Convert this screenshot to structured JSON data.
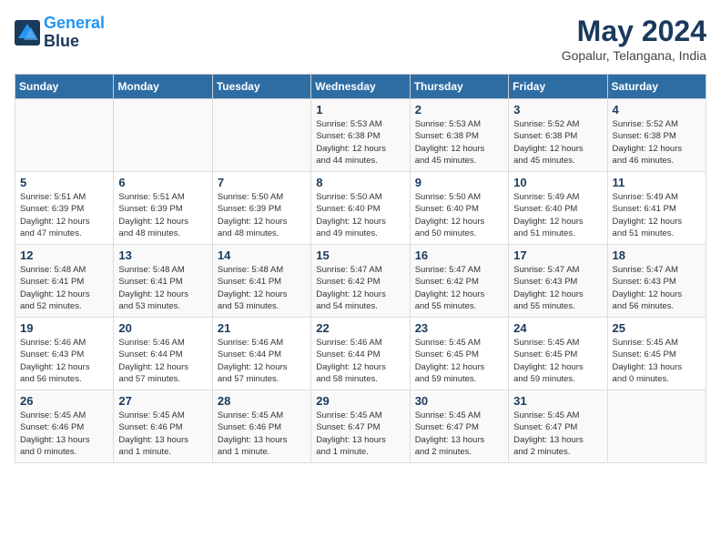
{
  "header": {
    "logo_line1": "General",
    "logo_line2": "Blue",
    "month_title": "May 2024",
    "subtitle": "Gopalur, Telangana, India"
  },
  "days_of_week": [
    "Sunday",
    "Monday",
    "Tuesday",
    "Wednesday",
    "Thursday",
    "Friday",
    "Saturday"
  ],
  "weeks": [
    [
      {
        "day": "",
        "info": ""
      },
      {
        "day": "",
        "info": ""
      },
      {
        "day": "",
        "info": ""
      },
      {
        "day": "1",
        "info": "Sunrise: 5:53 AM\nSunset: 6:38 PM\nDaylight: 12 hours\nand 44 minutes."
      },
      {
        "day": "2",
        "info": "Sunrise: 5:53 AM\nSunset: 6:38 PM\nDaylight: 12 hours\nand 45 minutes."
      },
      {
        "day": "3",
        "info": "Sunrise: 5:52 AM\nSunset: 6:38 PM\nDaylight: 12 hours\nand 45 minutes."
      },
      {
        "day": "4",
        "info": "Sunrise: 5:52 AM\nSunset: 6:38 PM\nDaylight: 12 hours\nand 46 minutes."
      }
    ],
    [
      {
        "day": "5",
        "info": "Sunrise: 5:51 AM\nSunset: 6:39 PM\nDaylight: 12 hours\nand 47 minutes."
      },
      {
        "day": "6",
        "info": "Sunrise: 5:51 AM\nSunset: 6:39 PM\nDaylight: 12 hours\nand 48 minutes."
      },
      {
        "day": "7",
        "info": "Sunrise: 5:50 AM\nSunset: 6:39 PM\nDaylight: 12 hours\nand 48 minutes."
      },
      {
        "day": "8",
        "info": "Sunrise: 5:50 AM\nSunset: 6:40 PM\nDaylight: 12 hours\nand 49 minutes."
      },
      {
        "day": "9",
        "info": "Sunrise: 5:50 AM\nSunset: 6:40 PM\nDaylight: 12 hours\nand 50 minutes."
      },
      {
        "day": "10",
        "info": "Sunrise: 5:49 AM\nSunset: 6:40 PM\nDaylight: 12 hours\nand 51 minutes."
      },
      {
        "day": "11",
        "info": "Sunrise: 5:49 AM\nSunset: 6:41 PM\nDaylight: 12 hours\nand 51 minutes."
      }
    ],
    [
      {
        "day": "12",
        "info": "Sunrise: 5:48 AM\nSunset: 6:41 PM\nDaylight: 12 hours\nand 52 minutes."
      },
      {
        "day": "13",
        "info": "Sunrise: 5:48 AM\nSunset: 6:41 PM\nDaylight: 12 hours\nand 53 minutes."
      },
      {
        "day": "14",
        "info": "Sunrise: 5:48 AM\nSunset: 6:41 PM\nDaylight: 12 hours\nand 53 minutes."
      },
      {
        "day": "15",
        "info": "Sunrise: 5:47 AM\nSunset: 6:42 PM\nDaylight: 12 hours\nand 54 minutes."
      },
      {
        "day": "16",
        "info": "Sunrise: 5:47 AM\nSunset: 6:42 PM\nDaylight: 12 hours\nand 55 minutes."
      },
      {
        "day": "17",
        "info": "Sunrise: 5:47 AM\nSunset: 6:43 PM\nDaylight: 12 hours\nand 55 minutes."
      },
      {
        "day": "18",
        "info": "Sunrise: 5:47 AM\nSunset: 6:43 PM\nDaylight: 12 hours\nand 56 minutes."
      }
    ],
    [
      {
        "day": "19",
        "info": "Sunrise: 5:46 AM\nSunset: 6:43 PM\nDaylight: 12 hours\nand 56 minutes."
      },
      {
        "day": "20",
        "info": "Sunrise: 5:46 AM\nSunset: 6:44 PM\nDaylight: 12 hours\nand 57 minutes."
      },
      {
        "day": "21",
        "info": "Sunrise: 5:46 AM\nSunset: 6:44 PM\nDaylight: 12 hours\nand 57 minutes."
      },
      {
        "day": "22",
        "info": "Sunrise: 5:46 AM\nSunset: 6:44 PM\nDaylight: 12 hours\nand 58 minutes."
      },
      {
        "day": "23",
        "info": "Sunrise: 5:45 AM\nSunset: 6:45 PM\nDaylight: 12 hours\nand 59 minutes."
      },
      {
        "day": "24",
        "info": "Sunrise: 5:45 AM\nSunset: 6:45 PM\nDaylight: 12 hours\nand 59 minutes."
      },
      {
        "day": "25",
        "info": "Sunrise: 5:45 AM\nSunset: 6:45 PM\nDaylight: 13 hours\nand 0 minutes."
      }
    ],
    [
      {
        "day": "26",
        "info": "Sunrise: 5:45 AM\nSunset: 6:46 PM\nDaylight: 13 hours\nand 0 minutes."
      },
      {
        "day": "27",
        "info": "Sunrise: 5:45 AM\nSunset: 6:46 PM\nDaylight: 13 hours\nand 1 minute."
      },
      {
        "day": "28",
        "info": "Sunrise: 5:45 AM\nSunset: 6:46 PM\nDaylight: 13 hours\nand 1 minute."
      },
      {
        "day": "29",
        "info": "Sunrise: 5:45 AM\nSunset: 6:47 PM\nDaylight: 13 hours\nand 1 minute."
      },
      {
        "day": "30",
        "info": "Sunrise: 5:45 AM\nSunset: 6:47 PM\nDaylight: 13 hours\nand 2 minutes."
      },
      {
        "day": "31",
        "info": "Sunrise: 5:45 AM\nSunset: 6:47 PM\nDaylight: 13 hours\nand 2 minutes."
      },
      {
        "day": "",
        "info": ""
      }
    ]
  ]
}
